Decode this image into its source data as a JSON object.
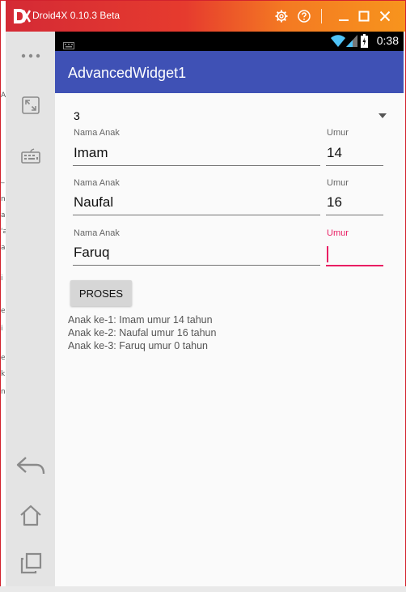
{
  "window": {
    "app_name": "Droid4X 0.10.3 Beta",
    "accent_color": "#d42a35"
  },
  "sidebar": {
    "items": [
      {
        "icon": "more-dots-icon"
      },
      {
        "icon": "fullscreen-icon"
      },
      {
        "icon": "keyboard-icon"
      },
      {
        "icon": "back-icon"
      },
      {
        "icon": "home-icon"
      },
      {
        "icon": "recent-apps-icon"
      }
    ]
  },
  "statusbar": {
    "time": "0:38",
    "icons": [
      "keyboard-icon",
      "wifi-icon",
      "signal-icon",
      "battery-icon"
    ]
  },
  "app": {
    "title": "AdvancedWidget1",
    "primary_color": "#3f51b5",
    "accent_color": "#e91e63"
  },
  "form": {
    "count_spinner": {
      "value": "3"
    },
    "rows": [
      {
        "name_label": "Nama Anak",
        "name_value": "Imam",
        "age_label": "Umur",
        "age_value": "14"
      },
      {
        "name_label": "Nama Anak",
        "name_value": "Naufal",
        "age_label": "Umur",
        "age_value": "16"
      },
      {
        "name_label": "Nama Anak",
        "name_value": "Faruq",
        "age_label": "Umur",
        "age_value": ""
      }
    ],
    "process_button": "PROSES"
  },
  "results": [
    "Anak ke-1: Imam umur 14 tahun",
    "Anak ke-2: Naufal umur 16 tahun",
    "Anak ke-3: Faruq umur 0 tahun"
  ]
}
